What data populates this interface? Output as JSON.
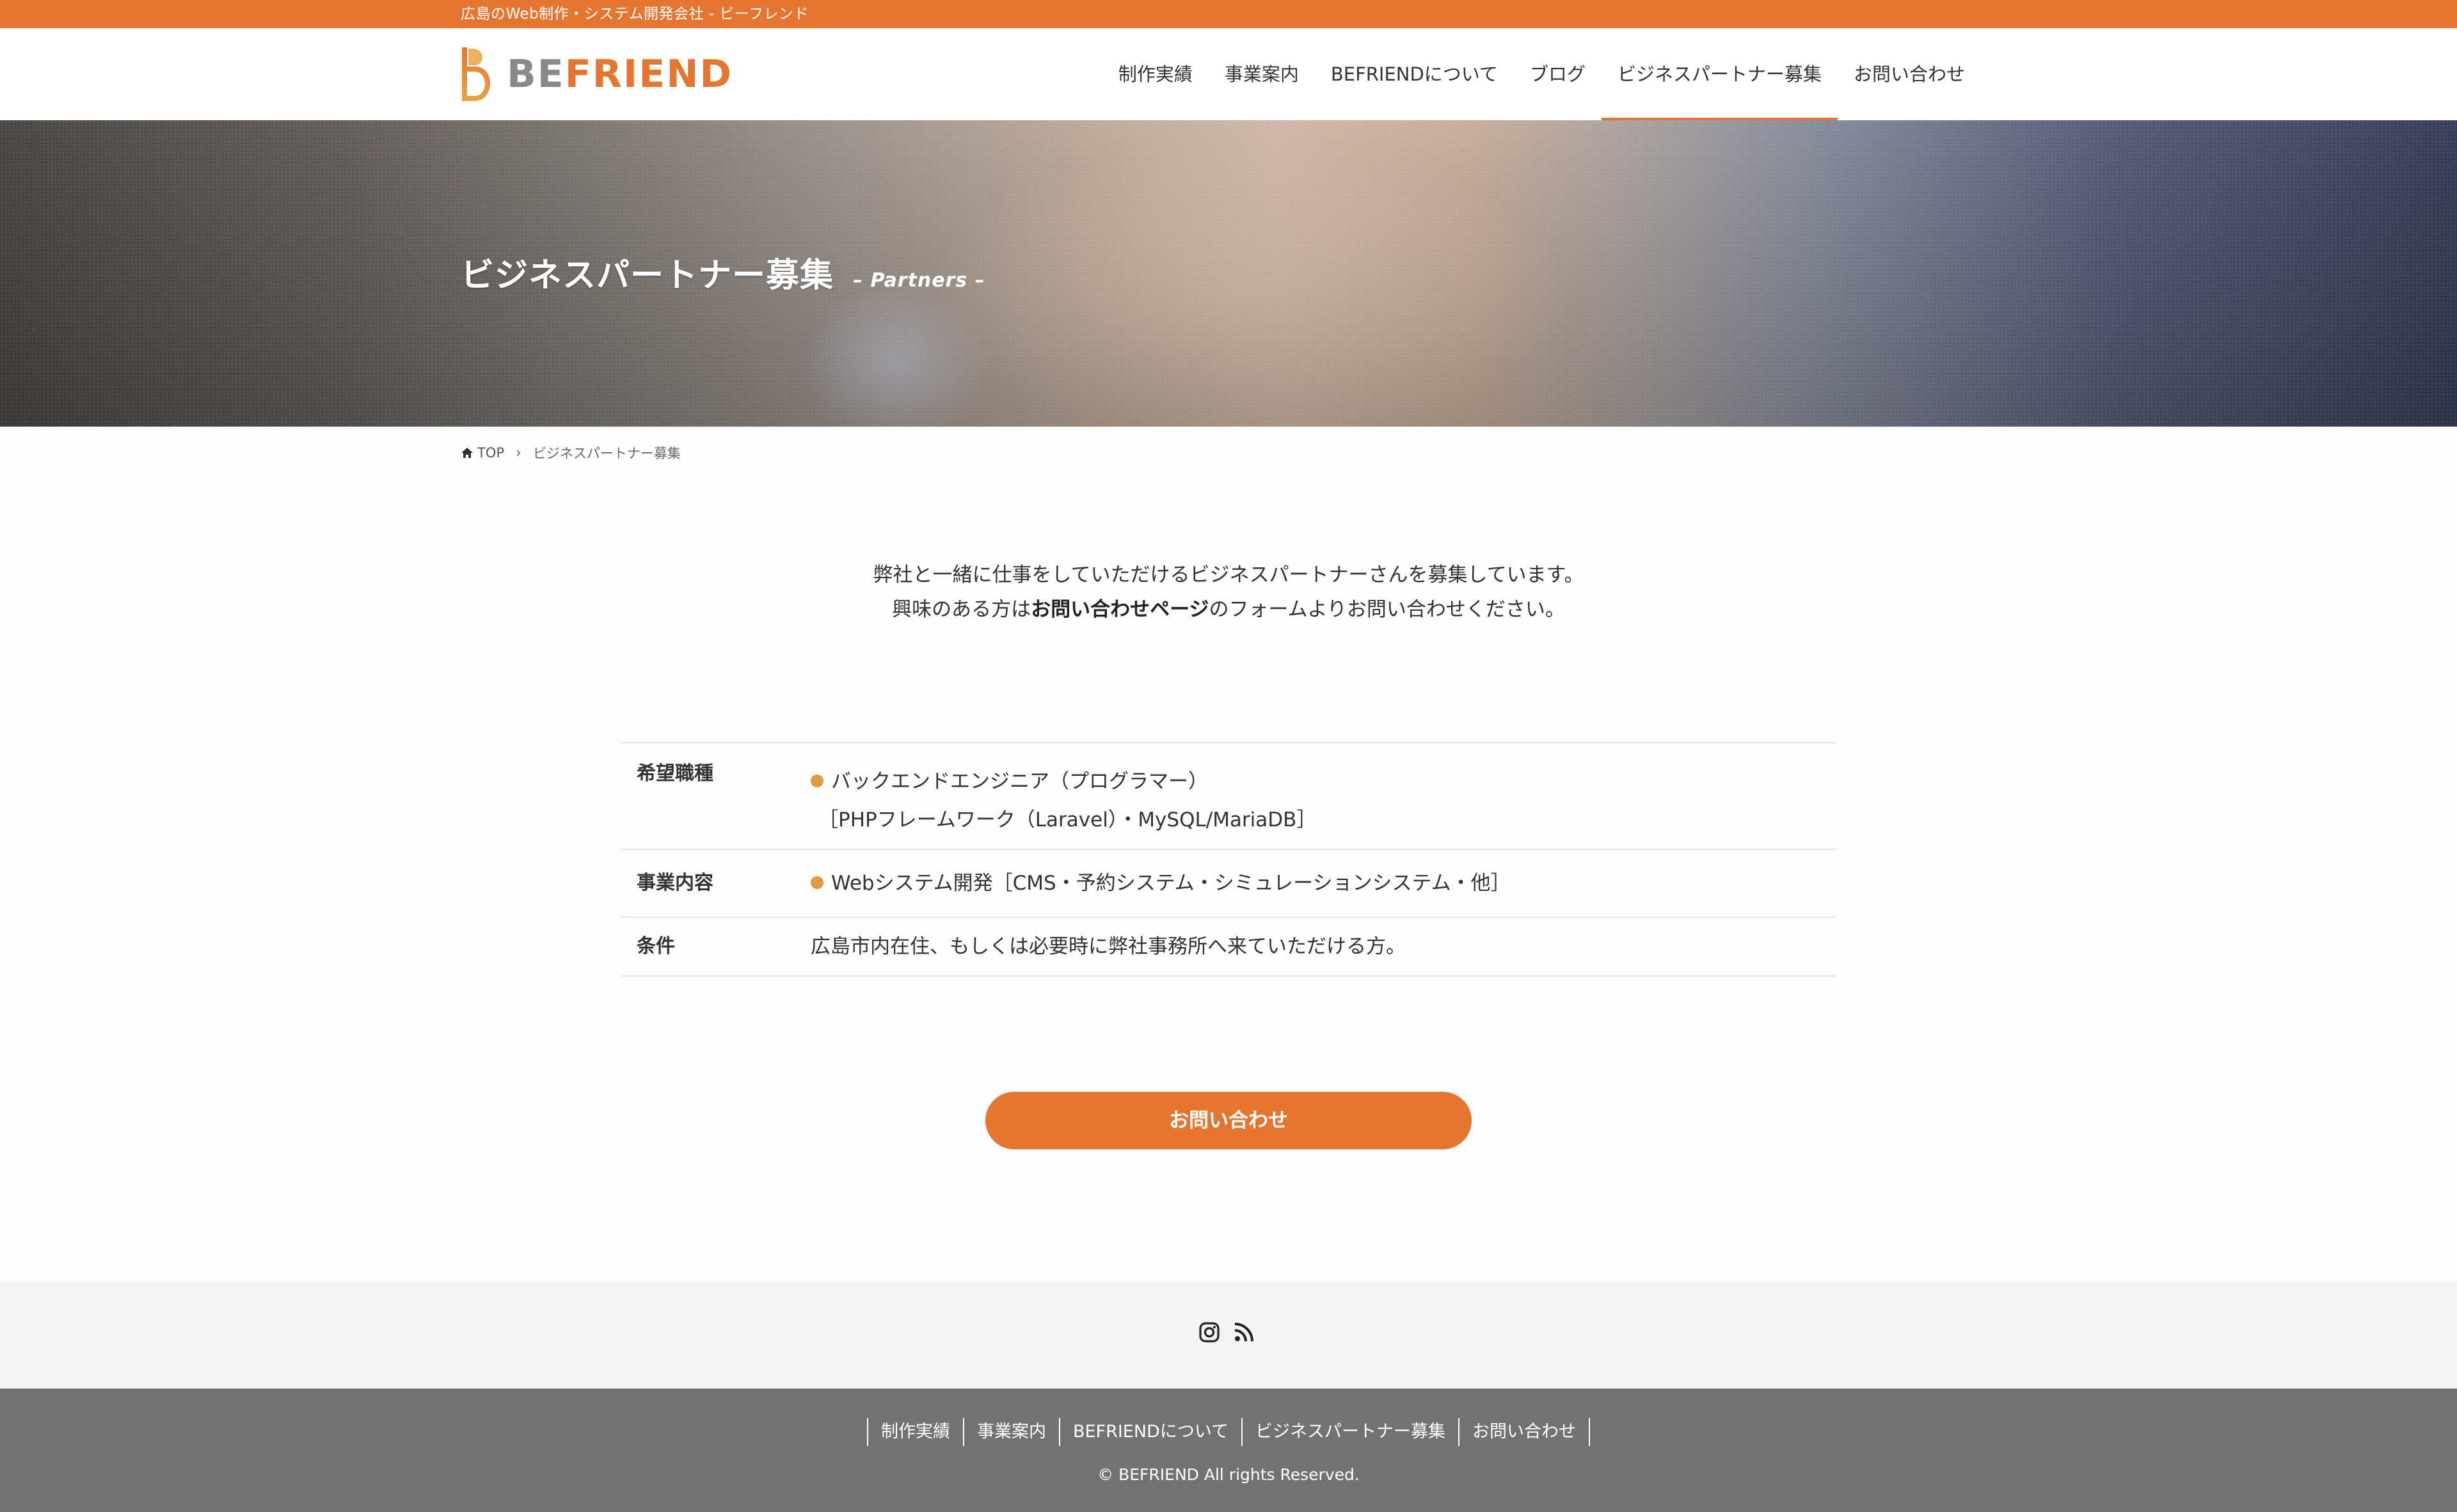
{
  "topbar": {
    "tagline": "広島のWeb制作・システム開発会社 - ビーフレンド"
  },
  "header": {
    "logo": {
      "be": "BE",
      "friend": "FRIEND"
    },
    "nav": [
      "制作実績",
      "事業案内",
      "BEFRIENDについて",
      "ブログ",
      "ビジネスパートナー募集",
      "お問い合わせ"
    ],
    "active_nav": "ビジネスパートナー募集"
  },
  "hero": {
    "title": "ビジネスパートナー募集",
    "subtitle": "– Partners –"
  },
  "breadcrumb": {
    "home": "TOP",
    "separator": "›",
    "current": "ビジネスパートナー募集"
  },
  "intro": {
    "line1": "弊社と一緒に仕事をしていただけるビジネスパートナーさんを募集しています。",
    "line2_prefix": "興味のある方は",
    "line2_bold": "お問い合わせページ",
    "line2_suffix": "のフォームよりお問い合わせください。"
  },
  "table": {
    "rows": [
      {
        "label": "希望職種",
        "lines": [
          "バックエンドエンジニア（プログラマー）",
          "［PHPフレームワーク（Laravel）・MySQL/MariaDB］"
        ]
      },
      {
        "label": "事業内容",
        "lines": [
          "Webシステム開発［CMS・予約システム・シミュレーションシステム・他］"
        ]
      },
      {
        "label": "条件",
        "lines": [
          "広島市内在住、もしくは必要時に弊社事務所へ来ていただける方。"
        ]
      }
    ]
  },
  "cta": {
    "label": "お問い合わせ"
  },
  "social": {
    "icons": [
      "instagram-icon",
      "rss-icon"
    ]
  },
  "footer": {
    "links": [
      "制作実績",
      "事業案内",
      "BEFRIENDについて",
      "ビジネスパートナー募集",
      "お問い合わせ"
    ],
    "copyright": "© BEFRIEND All rights Reserved."
  },
  "colors": {
    "accent": "#e57631",
    "bullet": "#e39a3e",
    "footer_bg": "#727272",
    "social_bg": "#f4f4f4"
  }
}
